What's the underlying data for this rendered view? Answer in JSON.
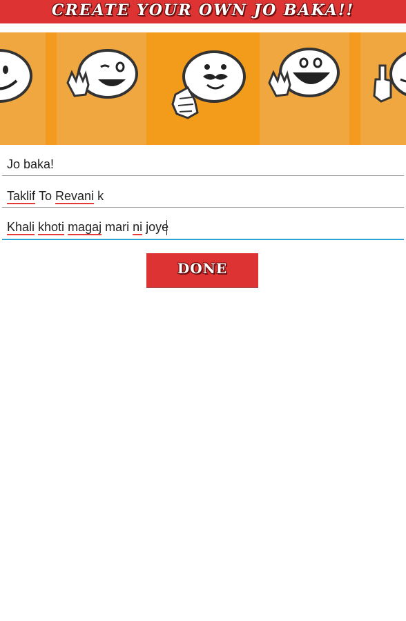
{
  "header": {
    "title": "CREATE YOUR OWN JO BAKA!!"
  },
  "emoji_strip": {
    "items": [
      {
        "icon": "smiling-face-icon",
        "selected": false
      },
      {
        "icon": "waving-winking-face-icon",
        "selected": false
      },
      {
        "icon": "mustache-thumbs-up-face-icon",
        "selected": true
      },
      {
        "icon": "laughing-waving-face-icon",
        "selected": false
      },
      {
        "icon": "middle-finger-face-icon",
        "selected": false
      }
    ]
  },
  "form": {
    "line1": "Jo baka!",
    "line2_words": [
      "Taklif",
      "To",
      "Revani",
      "k"
    ],
    "line3_words": [
      "Khali",
      "khoti",
      "magaj",
      "mari",
      "ni",
      "joye"
    ]
  },
  "done_button": {
    "label": "DONE"
  },
  "colors": {
    "banner_red": "#dd3333",
    "strip_orange": "#f2a23a",
    "active_underline": "#2aa3d9"
  }
}
